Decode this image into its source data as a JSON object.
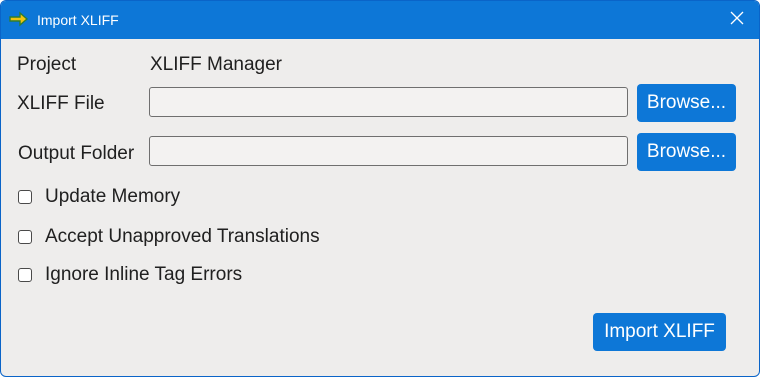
{
  "window": {
    "title": "Import XLIFF",
    "close_icon": "close-icon",
    "app_icon": "arrow-app-icon"
  },
  "form": {
    "project_label": "Project",
    "project_value": "XLIFF Manager",
    "xliff_file_label": "XLIFF File",
    "xliff_file_value": "",
    "output_folder_label": "Output Folder",
    "output_folder_value": "",
    "browse_label": "Browse..."
  },
  "options": [
    {
      "label": "Update Memory",
      "checked": false
    },
    {
      "label": "Accept Unapproved Translations",
      "checked": false
    },
    {
      "label": "Ignore Inline Tag Errors",
      "checked": false
    }
  ],
  "actions": {
    "import_label": "Import XLIFF"
  },
  "colors": {
    "accent": "#0d77d7",
    "background": "#eeedec"
  }
}
